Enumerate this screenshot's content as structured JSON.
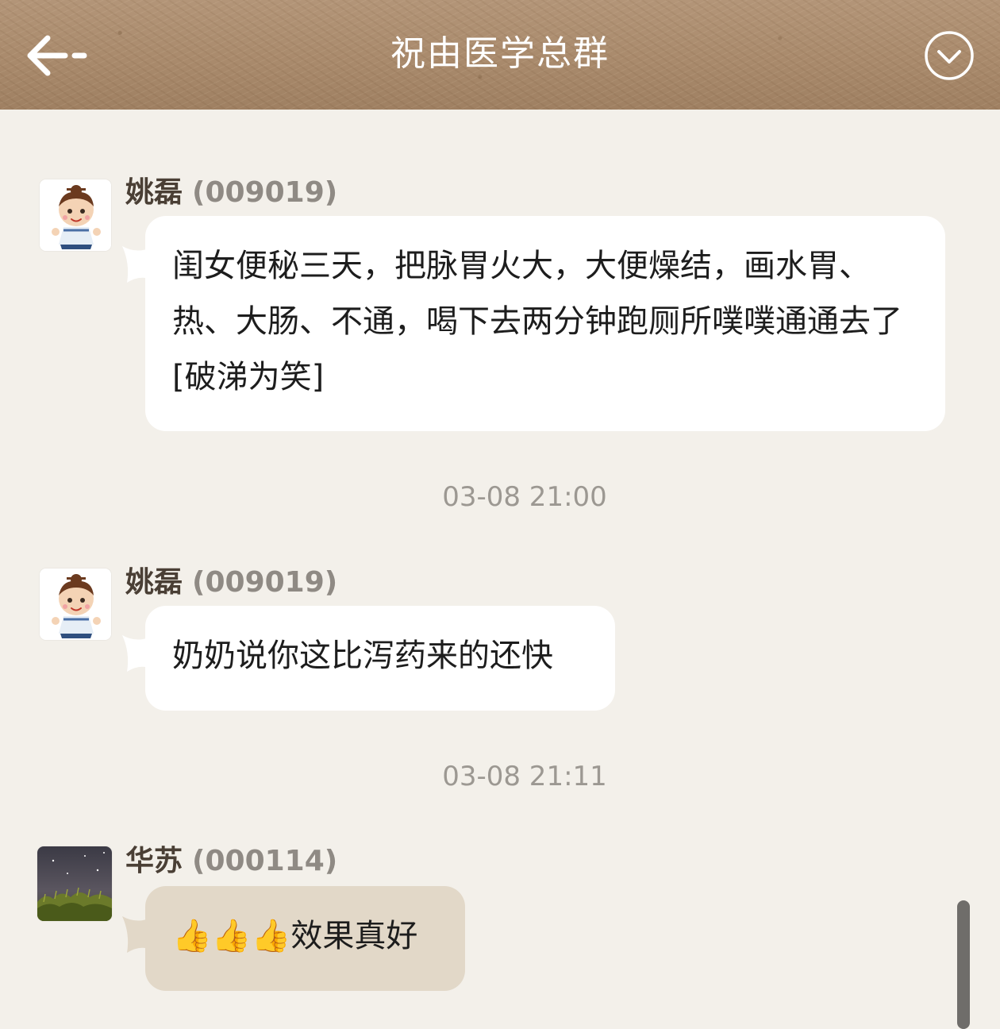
{
  "header": {
    "title": "祝由医学总群",
    "back_icon": "back-arrow-icon",
    "menu_icon": "chevron-down-circle-icon"
  },
  "messages": [
    {
      "sender_name": "姚磊",
      "sender_id": "(009019)",
      "text": "闺女便秘三天，把脉胃火大，大便燥结，画水胃、热、大肠、不通，喝下去两分钟跑厕所噗噗通通去了[破涕为笑]",
      "avatar_icon": "cartoon-child-avatar"
    },
    {
      "sender_name": "姚磊",
      "sender_id": "(009019)",
      "text": "奶奶说你这比泻药来的还快",
      "avatar_icon": "cartoon-child-avatar"
    },
    {
      "sender_name": "华苏",
      "sender_id": "(000114)",
      "text": "👍👍👍效果真好",
      "avatar_icon": "night-sky-grass-avatar"
    }
  ],
  "timestamps": [
    "03-08 21:00",
    "03-08 21:11"
  ],
  "colors": {
    "background": "#f3f0ea",
    "bubble": "#ffffff",
    "bubble_highlight": "#e2d8c8",
    "sender_name": "#4a3f35",
    "sender_id": "#8f8a84",
    "timestamp": "#9c9892"
  }
}
